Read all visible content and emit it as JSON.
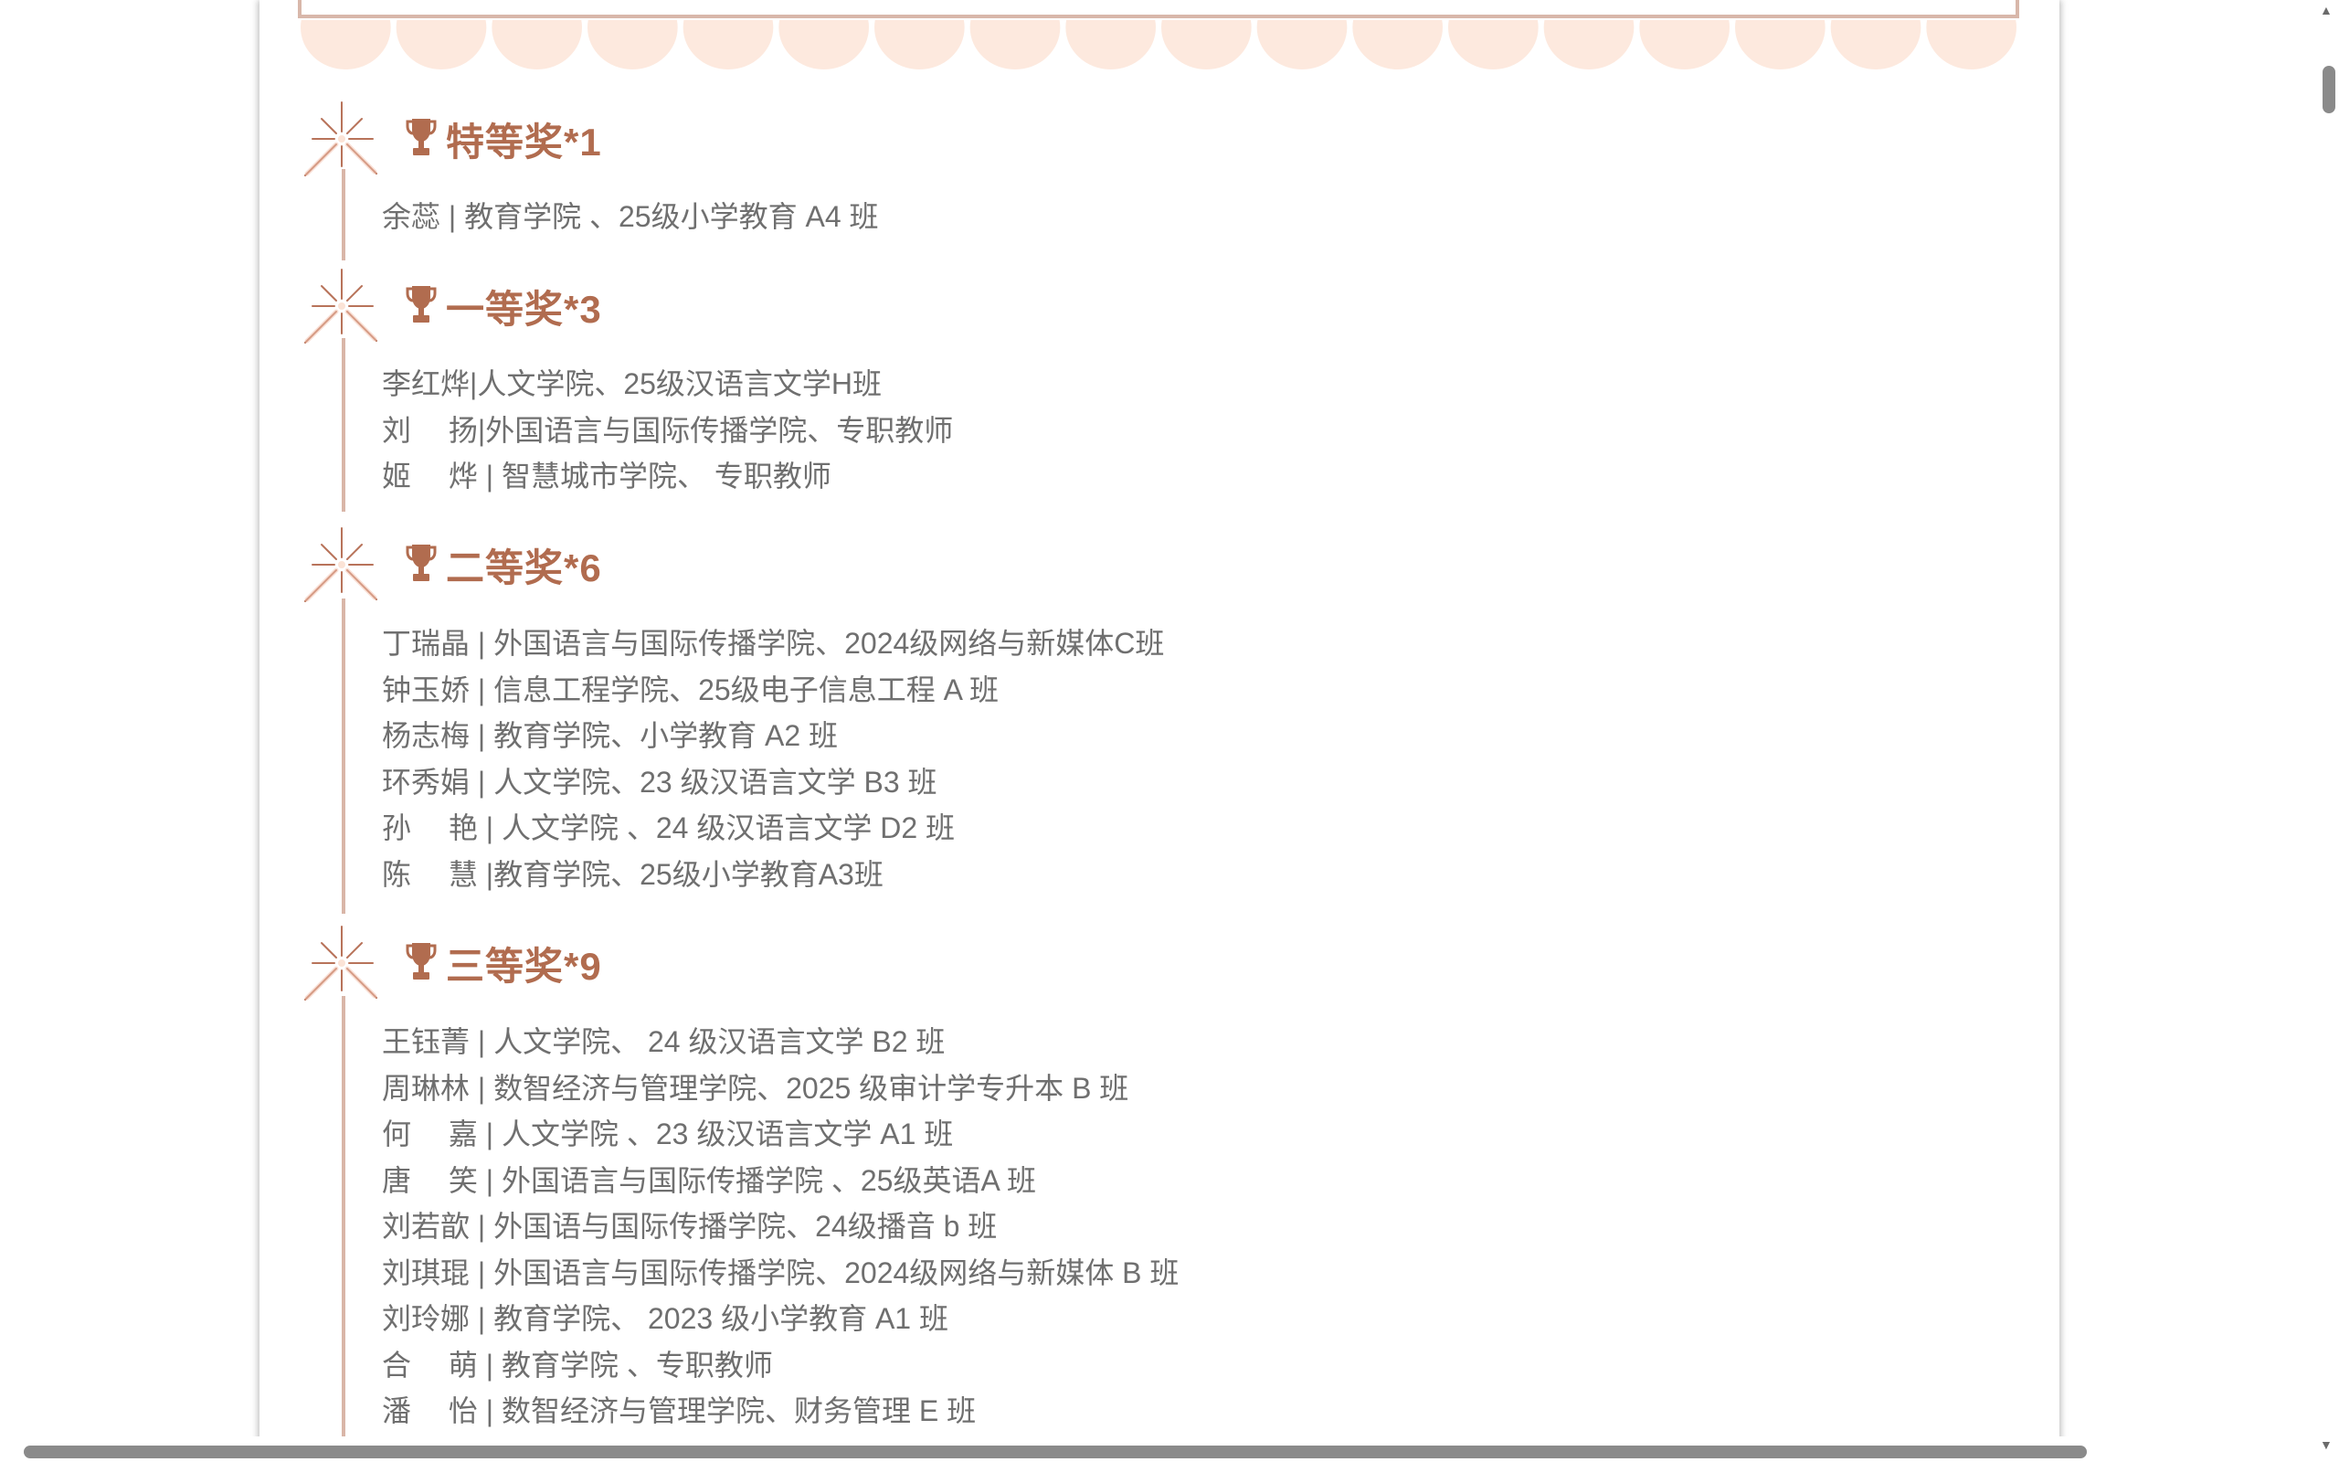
{
  "sections": [
    {
      "title": "特等奖*1",
      "entries": [
        "余蕊 | 教育学院 、25级小学教育 A4 班"
      ]
    },
    {
      "title": "一等奖*3",
      "entries": [
        "李红烨|人文学院、25级汉语言文学H班",
        "刘　 扬|外国语言与国际传播学院、专职教师",
        "姬　 烨 | 智慧城市学院、 专职教师"
      ]
    },
    {
      "title": "二等奖*6",
      "entries": [
        "丁瑞晶 | 外国语言与国际传播学院、2024级网络与新媒体C班",
        "钟玉娇 | 信息工程学院、25级电子信息工程 A 班",
        "杨志梅 | 教育学院、小学教育 A2 班",
        "环秀娟 | 人文学院、23 级汉语言文学 B3 班",
        "孙　 艳 | 人文学院 、24 级汉语言文学 D2 班",
        "陈　 慧 |教育学院、25级小学教育A3班"
      ]
    },
    {
      "title": "三等奖*9",
      "entries": [
        "王钰菁 | 人文学院、 24 级汉语言文学 B2 班",
        "周琳林 | 数智经济与管理学院、2025 级审计学专升本 B 班",
        "何　 嘉 | 人文学院 、23 级汉语言文学 A1 班",
        "唐　 笑 | 外国语言与国际传播学院 、25级英语A 班",
        "刘若歆 | 外国语与国际传播学院、24级播音 b 班",
        "刘琪琨 | 外国语言与国际传播学院、2024级网络与新媒体 B 班",
        "刘玲娜 | 教育学院、 2023 级小学教育 A1 班",
        "合　 萌 | 教育学院 、专职教师",
        "潘　 怡 | 数智经济与管理学院、财务管理 E 班"
      ]
    }
  ],
  "icons": {
    "award": "trophy-icon",
    "marker": "sparkle-icon"
  },
  "colors": {
    "accent": "#b16c4f",
    "text": "#6f6f6f",
    "line": "#d9b6a8",
    "scallop": "#fde9de"
  }
}
